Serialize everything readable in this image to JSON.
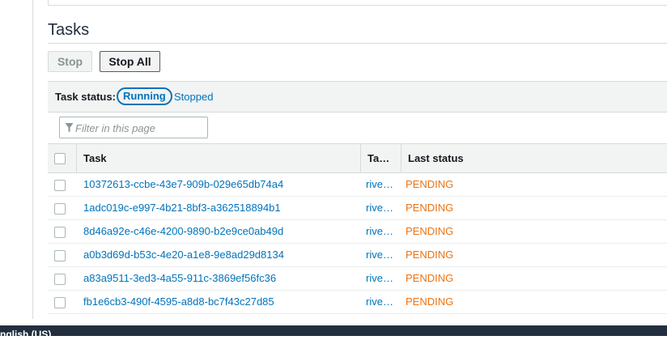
{
  "section": {
    "title": "Tasks"
  },
  "toolbar": {
    "stop_label": "Stop",
    "stop_all_label": "Stop All"
  },
  "status_filter": {
    "label": "Task status:",
    "running": "Running",
    "stopped": "Stopped",
    "selected": "Running"
  },
  "filter": {
    "placeholder": "Filter in this page"
  },
  "table": {
    "headers": {
      "task": "Task",
      "task_definition": "Ta…",
      "last_status": "Last status"
    },
    "rows": [
      {
        "task": "10372613-ccbe-43e7-909b-029e65db74a4",
        "task_definition": "rive…",
        "last_status": "PENDING"
      },
      {
        "task": "1adc019c-e997-4b21-8bf3-a362518894b1",
        "task_definition": "rive…",
        "last_status": "PENDING"
      },
      {
        "task": "8d46a92e-c46e-4200-9890-b2e9ce0ab49d",
        "task_definition": "rive…",
        "last_status": "PENDING"
      },
      {
        "task": "a0b3d69d-b53c-4e20-a1e8-9e8ad29d8134",
        "task_definition": "rive…",
        "last_status": "PENDING"
      },
      {
        "task": "a83a9511-3ed3-4a55-911c-3869ef56fc36",
        "task_definition": "rive…",
        "last_status": "PENDING"
      },
      {
        "task": "fb1e6cb3-490f-4595-a8d8-bc7f43c27d85",
        "task_definition": "rive…",
        "last_status": "PENDING"
      }
    ]
  },
  "footer": {
    "language": "nglish (US)"
  },
  "colors": {
    "link": "#0073bb",
    "pending": "#ec7211",
    "footer_bg": "#232f3e"
  },
  "icons": {
    "filter": "filter-icon"
  }
}
